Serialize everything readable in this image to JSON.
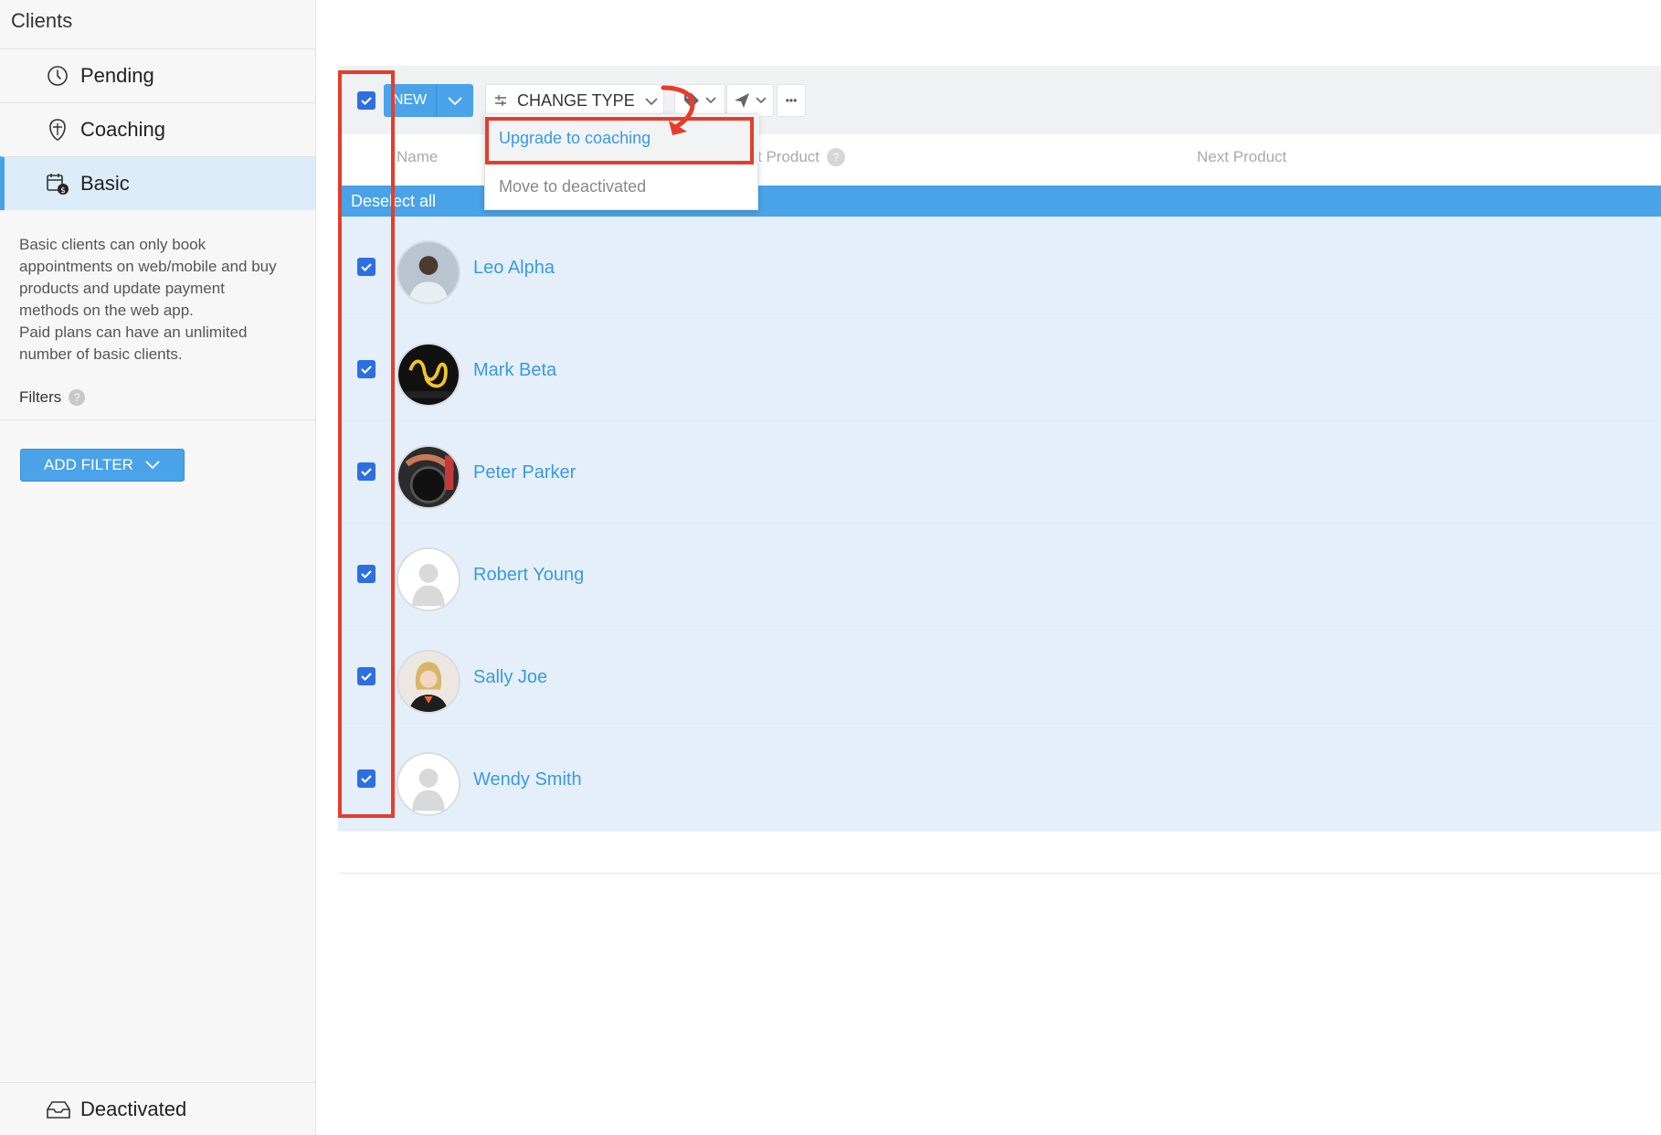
{
  "sidebar": {
    "title": "Clients",
    "nav": [
      {
        "label": "Pending",
        "icon": "clock-icon"
      },
      {
        "label": "Coaching",
        "icon": "whistle-icon"
      },
      {
        "label": "Basic",
        "icon": "calendar-dollar-icon"
      }
    ],
    "description_lines": [
      "Basic clients can only book",
      "appointments on web/mobile and buy",
      "products and update payment",
      "methods on the web app.",
      "Paid plans can have an unlimited",
      "number of basic clients."
    ],
    "filters_label": "Filters",
    "filters_help": "?",
    "add_filter_label": "ADD FILTER",
    "deactivated_label": "Deactivated"
  },
  "toolbar": {
    "new_label": "NEW",
    "change_type_label": "CHANGE TYPE",
    "more_label": "•••"
  },
  "table": {
    "columns": {
      "name": "Name",
      "product": "t Product",
      "next_product": "Next Product"
    },
    "product_help": "?",
    "deselect_label": "Deselect all",
    "clients": [
      {
        "name": "Leo Alpha",
        "avatar": "photo-man"
      },
      {
        "name": "Mark Beta",
        "avatar": "trainerize-logo"
      },
      {
        "name": "Peter Parker",
        "avatar": "photo-workout"
      },
      {
        "name": "Robert Young",
        "avatar": "placeholder"
      },
      {
        "name": "Sally Joe",
        "avatar": "photo-woman"
      },
      {
        "name": "Wendy Smith",
        "avatar": "placeholder"
      }
    ]
  },
  "dropdown": {
    "upgrade_label": "Upgrade to coaching",
    "deactivate_label": "Move to deactivated"
  },
  "colors": {
    "accent": "#4aa3e8",
    "checkbox": "#2d6fe0",
    "row_selected": "#e5effa",
    "annotation": "#e53d2b",
    "link": "#3a9ae0"
  }
}
